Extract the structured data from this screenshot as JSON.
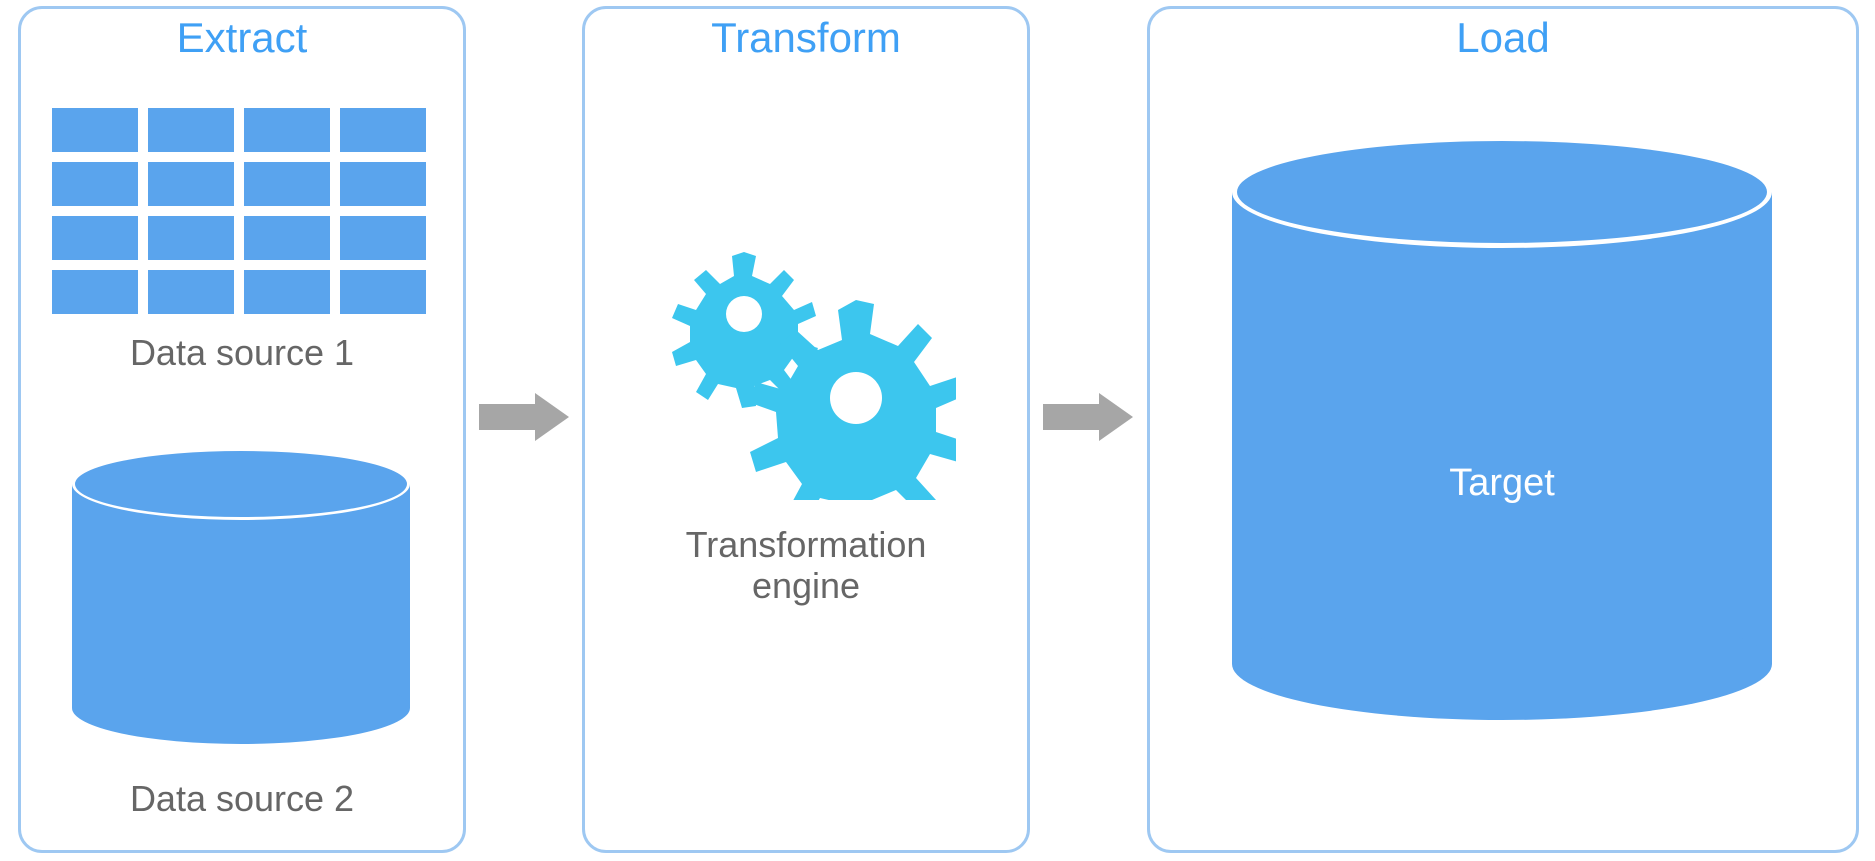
{
  "colors": {
    "border": "#9ec8f2",
    "title": "#3fa0f5",
    "fillBlue": "#5aa4ed",
    "gearBlue": "#3cc6ee",
    "arrow": "#a6a6a6",
    "textGray": "#666666",
    "white": "#ffffff"
  },
  "stages": {
    "extract": {
      "title": "Extract",
      "source1_label": "Data source 1",
      "source2_label": "Data source 2"
    },
    "transform": {
      "title": "Transform",
      "engine_label_line1": "Transformation",
      "engine_label_line2": "engine"
    },
    "load": {
      "title": "Load",
      "target_label": "Target"
    }
  }
}
